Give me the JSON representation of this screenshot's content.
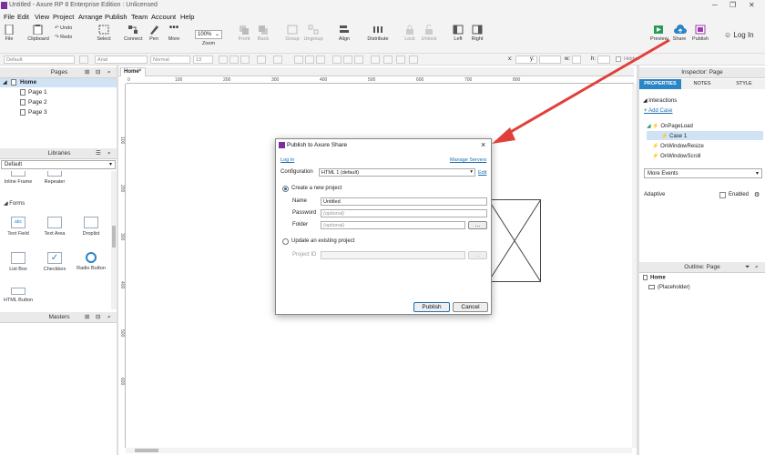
{
  "window": {
    "title": "Untitled - Axure RP 8 Enterprise Edition : Unlicensed"
  },
  "menu": [
    "File",
    "Edit",
    "View",
    "Project",
    "Arrange",
    "Publish",
    "Team",
    "Account",
    "Help"
  ],
  "toolbar": {
    "file": "File",
    "clipboard": "Clipboard",
    "undo": "Undo",
    "redo": "Redo",
    "select": "Select",
    "connect": "Connect",
    "pen": "Pen",
    "more": "More",
    "zoom_value": "100%",
    "zoom": "Zoom",
    "front": "Front",
    "back": "Back",
    "group": "Group",
    "ungroup": "Ungroup",
    "align": "Align",
    "distribute": "Distribute",
    "lock": "Lock",
    "unlock": "Unlock",
    "left": "Left",
    "right": "Right",
    "preview": "Preview",
    "share": "Share",
    "publish": "Publish",
    "login": "Log In"
  },
  "format": {
    "style": "Default",
    "font": "Arial",
    "weight": "Normal",
    "size": "13",
    "x": "x:",
    "y": "y:",
    "w": "w:",
    "h": "h:",
    "hidden": "Hidden"
  },
  "pages": {
    "title": "Pages",
    "home": "Home",
    "items": [
      "Page 1",
      "Page 2",
      "Page 3"
    ]
  },
  "libraries": {
    "title": "Libraries",
    "selected": "Default",
    "top": [
      "Inline Frame",
      "Repeater"
    ],
    "forms_title": "Forms",
    "forms": [
      "Text Field",
      "Text Area",
      "Droplist",
      "List Box",
      "Checkbox",
      "Radio Button",
      "HTML Button"
    ]
  },
  "masters": {
    "title": "Masters"
  },
  "doc_tab": {
    "label": "Home"
  },
  "ruler_h": [
    "0",
    "100",
    "200",
    "300",
    "400",
    "500",
    "600",
    "700",
    "800"
  ],
  "ruler_v": [
    "100",
    "200",
    "300",
    "400",
    "500",
    "600",
    "700"
  ],
  "modal": {
    "title": "Publish to Axure Share",
    "login": "Log In",
    "manage": "Manage Servers",
    "config_label": "Configuration",
    "config_value": "HTML 1 (default)",
    "edit": "Edit",
    "create_label": "Create a new project",
    "name_label": "Name",
    "name_value": "Untitled",
    "password_label": "Password",
    "password_ph": "(optional)",
    "folder_label": "Folder",
    "folder_ph": "(optional)",
    "browse": "...",
    "update_label": "Update an existing project",
    "projectid_label": "Project ID",
    "publish_btn": "Publish",
    "cancel_btn": "Cancel"
  },
  "inspector": {
    "title": "Inspector: Page",
    "tabs": [
      "PROPERTIES",
      "NOTES",
      "STYLE"
    ],
    "interactions": "Interactions",
    "add_case": "Add Case",
    "events": [
      "OnPageLoad",
      "Case 1",
      "OnWindowResize",
      "OnWindowScroll"
    ],
    "more_events": "More Events",
    "adaptive": "Adaptive",
    "enabled": "Enabled"
  },
  "outline": {
    "title": "Outline: Page",
    "home": "Home",
    "placeholder": "(Placeholder)"
  },
  "colors": {
    "accent": "#1a6fb0",
    "arrow": "#e0403a",
    "tab_active": "#2a84c6",
    "selected_row": "#cfe3f5"
  }
}
